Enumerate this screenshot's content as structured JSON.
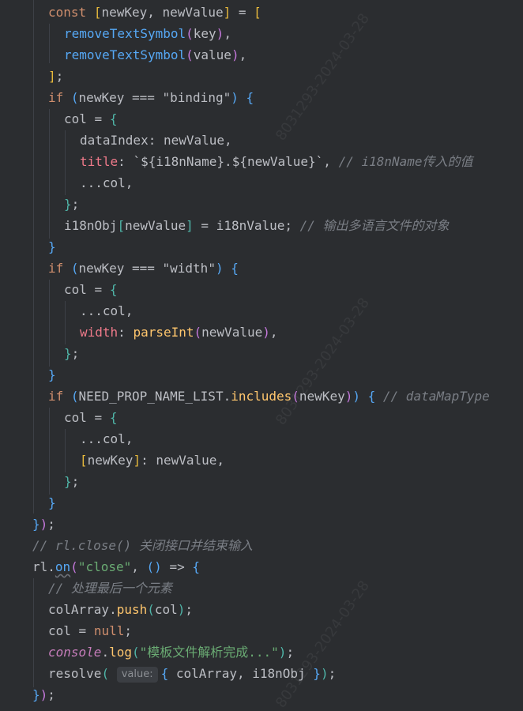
{
  "code": {
    "l1": {
      "kw": "const",
      "open": "[",
      "a": "newKey",
      "comma": ",",
      "b": "newValue",
      "close": "]",
      "eq": "=",
      "open2": "["
    },
    "l2": {
      "fn": "removeTextSymbol",
      "po": "(",
      "arg": "key",
      "pc": ")",
      "tail": ","
    },
    "l3": {
      "fn": "removeTextSymbol",
      "po": "(",
      "arg": "value",
      "pc": ")",
      "tail": ","
    },
    "l4": {
      "close": "]",
      "semi": ";"
    },
    "l5": {
      "kw": "if",
      "po": "(",
      "left": "newKey ===",
      "str": "\"binding\"",
      "pc": ")",
      "br": "{"
    },
    "l6": {
      "v": "col =",
      "br": "{"
    },
    "l7": {
      "key": "dataIndex",
      "rest": ": newValue,"
    },
    "l8": {
      "key": "title",
      "c": ":",
      "t1": "`${",
      "v1": "i18nName",
      "t2": "}.${",
      "v2": "newValue",
      "t3": "}`",
      "comma": ",",
      "cm": "// i18nName传入的值"
    },
    "l9": {
      "spread": "...col,"
    },
    "l10": {
      "br": "}",
      "semi": ";"
    },
    "l11": {
      "a": "i18nObj",
      "bo": "[",
      "b": "newValue",
      "bc": "]",
      "rest": " = i18nValue;",
      "cm": "// 输出多语言文件的对象"
    },
    "l12": {
      "br": "}"
    },
    "l13": {
      "kw": "if",
      "po": "(",
      "left": "newKey ===",
      "str": "\"width\"",
      "pc": ")",
      "br": "{"
    },
    "l14": {
      "v": "col =",
      "br": "{"
    },
    "l15": {
      "spread": "...col,"
    },
    "l16": {
      "key": "width",
      "c": ":",
      "fn": "parseInt",
      "po": "(",
      "arg": "newValue",
      "pc": ")",
      "comma": ","
    },
    "l17": {
      "br": "}",
      "semi": ";"
    },
    "l18": {
      "br": "}"
    },
    "l19": {
      "kw": "if",
      "po": "(",
      "a": "NEED_PROP_NAME_LIST.",
      "fn": "includes",
      "po2": "(",
      "arg": "newKey",
      "pc2": ")",
      "pc": ")",
      "br": "{",
      "cm": "// dataMapType"
    },
    "l20": {
      "v": "col =",
      "br": "{"
    },
    "l21": {
      "spread": "...col,"
    },
    "l22": {
      "bo": "[",
      "key": "newKey",
      "bc": "]",
      "rest": ": newValue,"
    },
    "l23": {
      "br": "}",
      "semi": ";"
    },
    "l24": {
      "br": "}"
    },
    "l25": {
      "br": "}",
      "pc": ")",
      "semi": ";"
    },
    "l26": {
      "cm": "// rl.close() 关闭接口并结束输入"
    },
    "l27": {
      "a": "rl.",
      "fn": "on",
      "po": "(",
      "str": "\"close\"",
      "comma": ",",
      "paren": "()",
      "arrow": "=>",
      "br": "{"
    },
    "l28": {
      "cm": "// 处理最后一个元素"
    },
    "l29": {
      "a": "colArray.",
      "fn": "push",
      "po": "(",
      "arg": "col",
      "pc": ")",
      "semi": ";"
    },
    "l30": {
      "a": "col =",
      "kw": "null",
      "semi": ";"
    },
    "l31": {
      "obj": "console",
      "dot": ".",
      "fn": "log",
      "po": "(",
      "str": "\"模板文件解析完成...\"",
      "pc": ")",
      "semi": ";"
    },
    "l32": {
      "fn": "resolve",
      "po": "(",
      "hint": "value:",
      "bo": "{",
      "mid": "colArray, i18nObj",
      "bc": "}",
      "pc": ")",
      "semi": ";"
    },
    "l33": {
      "br": "}",
      "pc": ")",
      "semi": ";"
    }
  },
  "watermark": "8031293-2024-03-28",
  "colors": {
    "background": "#2b2d30",
    "keyword": "#cf8e6d",
    "function": "#56a8f5",
    "property": "#c77dbb",
    "string": "#6aab73",
    "comment": "#7a7e85"
  }
}
